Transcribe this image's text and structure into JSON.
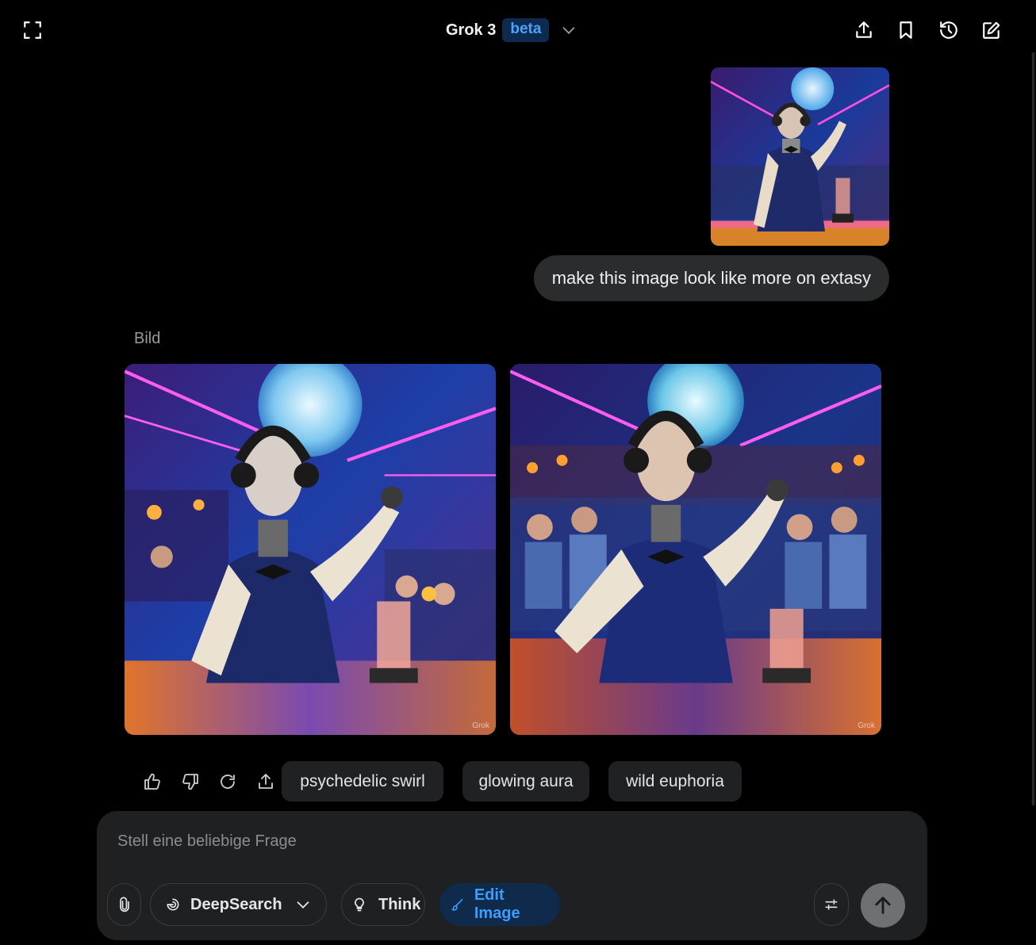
{
  "header": {
    "model_name": "Grok 3",
    "model_badge": "beta",
    "icons": [
      "fullscreen-icon",
      "chevron-down-icon",
      "share-icon",
      "bookmark-icon",
      "history-icon",
      "new-chat-icon"
    ]
  },
  "conversation": {
    "user_message": {
      "text": "make this image look like more on extasy",
      "has_image_attachment": true
    },
    "response": {
      "label": "Bild",
      "images": [
        {
          "watermark": "Grok"
        },
        {
          "watermark": "Grok"
        }
      ],
      "actions": [
        "thumbs-up-icon",
        "thumbs-down-icon",
        "regenerate-icon",
        "share-icon"
      ],
      "suggestions": [
        "psychedelic swirl",
        "glowing aura",
        "wild euphoria"
      ]
    }
  },
  "composer": {
    "placeholder": "Stell eine beliebige Frage",
    "value": "",
    "deepsearch_label": "DeepSearch",
    "think_label": "Think",
    "edit_image_label": "Edit Image"
  },
  "colors": {
    "background": "#000000",
    "accent": "#3b9dff",
    "bubble": "#2a2c2e",
    "composer": "#1e2022"
  }
}
